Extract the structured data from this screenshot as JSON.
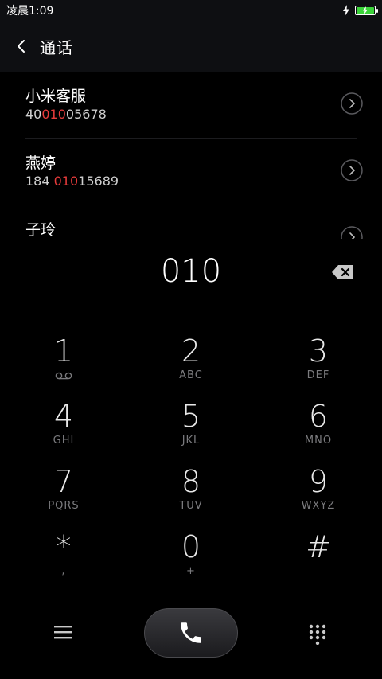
{
  "status_bar": {
    "time": "凌晨1:09",
    "charging_icon": "bolt-icon",
    "battery_icon": "battery-charging-icon",
    "battery_color": "#3bd43a"
  },
  "header": {
    "back_icon": "chevron-left-icon",
    "title": "通话"
  },
  "contacts": [
    {
      "name": "小米客服",
      "number_pre": "40",
      "number_match": "010",
      "number_post": "05678"
    },
    {
      "name": "燕婷",
      "number_pre": "184 ",
      "number_match": "010",
      "number_post": "15689"
    },
    {
      "name": "子玲",
      "number_pre": "",
      "number_match": "",
      "number_post": ""
    }
  ],
  "highlight_color": "#e63b3b",
  "dialer": {
    "number": "010",
    "backspace_icon": "backspace-icon"
  },
  "keypad": [
    {
      "digit": "1",
      "letters": "",
      "icon": "voicemail-icon"
    },
    {
      "digit": "2",
      "letters": "ABC"
    },
    {
      "digit": "3",
      "letters": "DEF"
    },
    {
      "digit": "4",
      "letters": "GHI"
    },
    {
      "digit": "5",
      "letters": "JKL"
    },
    {
      "digit": "6",
      "letters": "MNO"
    },
    {
      "digit": "7",
      "letters": "PQRS"
    },
    {
      "digit": "8",
      "letters": "TUV"
    },
    {
      "digit": "9",
      "letters": "WXYZ"
    },
    {
      "digit": "*",
      "letters": ","
    },
    {
      "digit": "0",
      "letters": "+"
    },
    {
      "digit": "#",
      "letters": ""
    }
  ],
  "bottom_bar": {
    "menu_icon": "menu-icon",
    "call_icon": "phone-icon",
    "dialpad_icon": "dialpad-icon"
  }
}
